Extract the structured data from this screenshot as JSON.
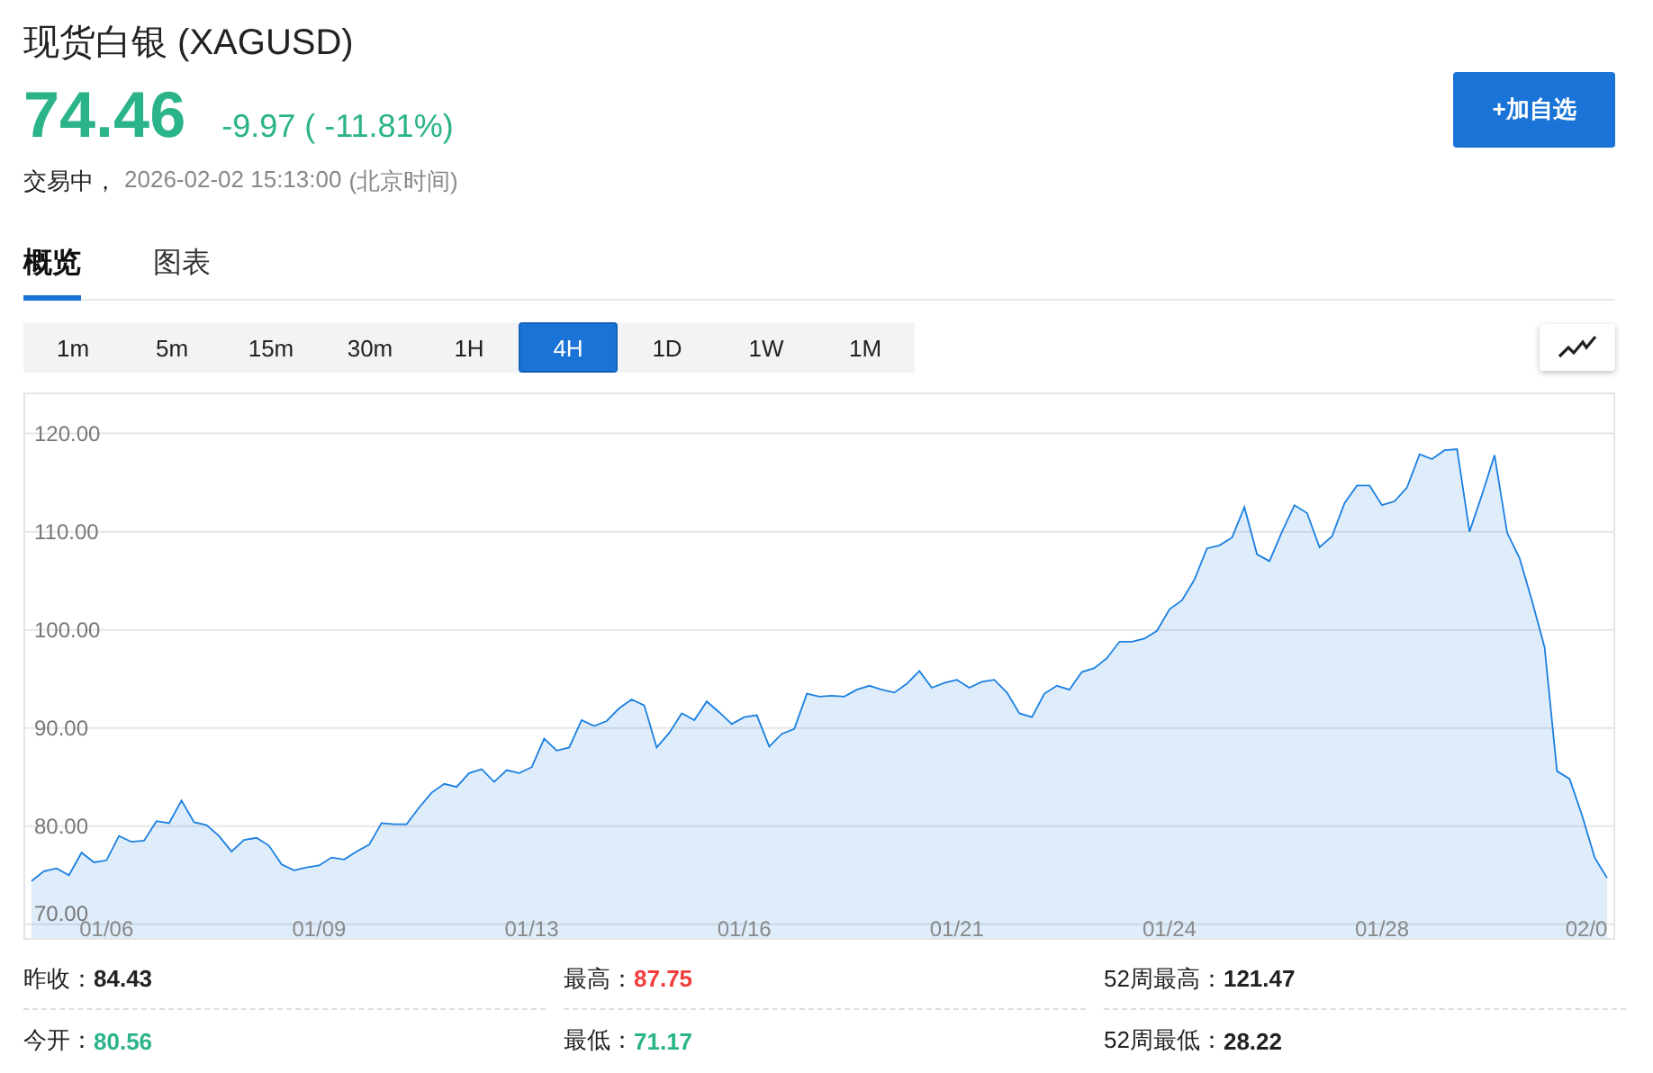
{
  "title": "现货白银 (XAGUSD)",
  "quote": {
    "price": "74.46",
    "change": "-9.97 ( -11.81%)",
    "status": "交易中，",
    "timestamp": "2026-02-02 15:13:00",
    "timezone": "(北京时间)"
  },
  "add_button": "+加自选",
  "tabs": [
    {
      "label": "概览",
      "selected": true
    },
    {
      "label": "图表",
      "selected": false
    }
  ],
  "intervals": [
    {
      "label": "1m",
      "selected": false
    },
    {
      "label": "5m",
      "selected": false
    },
    {
      "label": "15m",
      "selected": false
    },
    {
      "label": "30m",
      "selected": false
    },
    {
      "label": "1H",
      "selected": false
    },
    {
      "label": "4H",
      "selected": true
    },
    {
      "label": "1D",
      "selected": false
    },
    {
      "label": "1W",
      "selected": false
    },
    {
      "label": "1M",
      "selected": false
    }
  ],
  "chart_data": {
    "type": "area",
    "grid": true,
    "ylim": [
      68.6,
      124
    ],
    "categories": [
      null,
      null,
      null,
      null,
      null,
      null,
      "01/06",
      null,
      null,
      null,
      null,
      null,
      null,
      null,
      null,
      null,
      null,
      null,
      null,
      null,
      null,
      null,
      null,
      "01/09",
      null,
      null,
      null,
      null,
      null,
      null,
      null,
      null,
      null,
      null,
      null,
      null,
      null,
      null,
      null,
      null,
      "01/13",
      null,
      null,
      null,
      null,
      null,
      null,
      null,
      null,
      null,
      null,
      null,
      null,
      null,
      null,
      null,
      null,
      "01/16",
      null,
      null,
      null,
      null,
      null,
      null,
      null,
      null,
      null,
      null,
      null,
      null,
      null,
      null,
      null,
      null,
      "01/21",
      null,
      null,
      null,
      null,
      null,
      null,
      null,
      null,
      null,
      null,
      null,
      null,
      null,
      null,
      null,
      null,
      "01/24",
      null,
      null,
      null,
      null,
      null,
      null,
      null,
      null,
      null,
      null,
      null,
      null,
      null,
      null,
      null,
      null,
      "01/28",
      null,
      null,
      null,
      null,
      null,
      null,
      null,
      null,
      null,
      null,
      null,
      null,
      null,
      null,
      null,
      null,
      "02/0",
      null
    ],
    "yticks": [
      {
        "value": 70,
        "label": "70.00"
      },
      {
        "value": 80,
        "label": "80.00"
      },
      {
        "value": 90,
        "label": "90.00"
      },
      {
        "value": 100,
        "label": "100.00"
      },
      {
        "value": 110,
        "label": "110.00"
      },
      {
        "value": 120,
        "label": "120.00"
      }
    ],
    "series": [
      {
        "color": "#1a7fe0",
        "values": [
          74.4,
          75.4,
          75.7,
          75.0,
          77.3,
          76.3,
          76.5,
          79.0,
          78.4,
          78.5,
          80.5,
          80.3,
          82.6,
          80.4,
          80.1,
          79.0,
          77.4,
          78.6,
          78.8,
          78.0,
          76.1,
          75.5,
          75.8,
          76.0,
          76.8,
          76.6,
          77.4,
          78.1,
          80.3,
          80.2,
          80.2,
          81.9,
          83.4,
          84.3,
          84.0,
          85.4,
          85.8,
          84.5,
          85.7,
          85.4,
          86.0,
          88.9,
          87.7,
          88.0,
          90.8,
          90.2,
          90.7,
          92.0,
          92.9,
          92.3,
          88.0,
          89.5,
          91.5,
          90.8,
          92.7,
          91.6,
          90.4,
          91.1,
          91.3,
          88.1,
          89.4,
          89.9,
          93.5,
          93.2,
          93.3,
          93.2,
          93.9,
          94.3,
          93.9,
          93.6,
          94.5,
          95.8,
          94.1,
          94.6,
          94.9,
          94.1,
          94.7,
          94.9,
          93.6,
          91.5,
          91.1,
          93.5,
          94.3,
          93.9,
          95.7,
          96.1,
          97.1,
          98.8,
          98.8,
          99.1,
          99.9,
          102.1,
          103.0,
          105.1,
          108.3,
          108.6,
          109.4,
          112.5,
          107.7,
          107.0,
          110.0,
          112.7,
          111.9,
          108.4,
          109.5,
          112.9,
          114.7,
          114.7,
          112.7,
          113.1,
          114.5,
          117.9,
          117.4,
          118.3,
          118.4,
          110.0,
          113.8,
          117.8,
          109.9,
          107.3,
          102.9,
          98.2,
          85.6,
          84.8,
          81.1,
          76.8,
          74.7
        ]
      }
    ]
  },
  "stats": [
    {
      "label": "昨收：",
      "value": "84.43",
      "color": "#222222"
    },
    {
      "label": "最高：",
      "value": "87.75",
      "color": "#f23b3b"
    },
    {
      "label": "52周最高：",
      "value": "121.47",
      "color": "#222222"
    },
    {
      "label": "今开：",
      "value": "80.56",
      "color": "#2bb38a"
    },
    {
      "label": "最低：",
      "value": "71.17",
      "color": "#2bb38a"
    },
    {
      "label": "52周最低：",
      "value": "28.22",
      "color": "#222222"
    }
  ]
}
